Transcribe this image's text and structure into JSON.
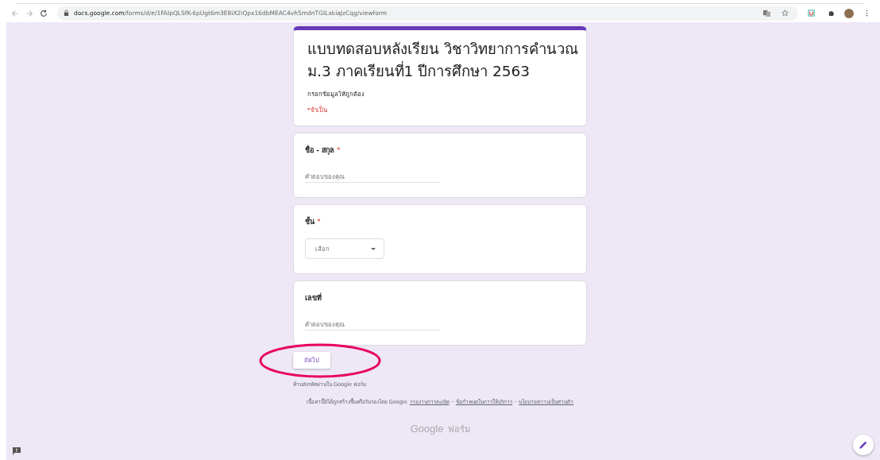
{
  "browser": {
    "url_domain": "docs.google.com",
    "url_path": "/forms/d/e/1FAIpQLSfK-6pUgt6m3E8iX2iQpx16dbMEAC4vh5mdnTGILxkiaJzCqg/viewform"
  },
  "form": {
    "title": "แบบทดสอบหลังเรียน วิชาวิทยาการคำนวณ ม.3 ภาคเรียนที่1 ปีการศึกษา 2563",
    "description": "กรอกข้อมูลให้ถูกต้อง",
    "required_note": "*จำเป็น"
  },
  "questions": [
    {
      "kind": "text",
      "label": "ชื่อ - สกุล",
      "required_mark": "*",
      "placeholder": "คำตอบของคุณ"
    },
    {
      "kind": "dropdown",
      "label": "ชั้น",
      "required_mark": "*",
      "placeholder": "เลือก"
    },
    {
      "kind": "text",
      "label": "เลขที่",
      "placeholder": "คำตอบของคุณ"
    }
  ],
  "next_button": "ถัดไป",
  "password_warning": "ห้ามส่งรหัสผ่านใน Google ฟอร์ม",
  "footer": {
    "disclaimer": "เนื้อหานี้มิได้ถูกสร้างขึ้นหรือรับรองโดย Google",
    "items": [
      {
        "kind": "link",
        "text": "รายงานการละเมิด"
      },
      {
        "kind": "separator",
        "text": "-"
      },
      {
        "kind": "link",
        "text": "ข้อกำหนดในการให้บริการ"
      },
      {
        "kind": "separator",
        "text": "-"
      },
      {
        "kind": "link",
        "text": "นโยบายความเป็นส่วนตัว"
      }
    ]
  },
  "logo": {
    "brand": "Google",
    "product": "ฟอร์ม"
  }
}
